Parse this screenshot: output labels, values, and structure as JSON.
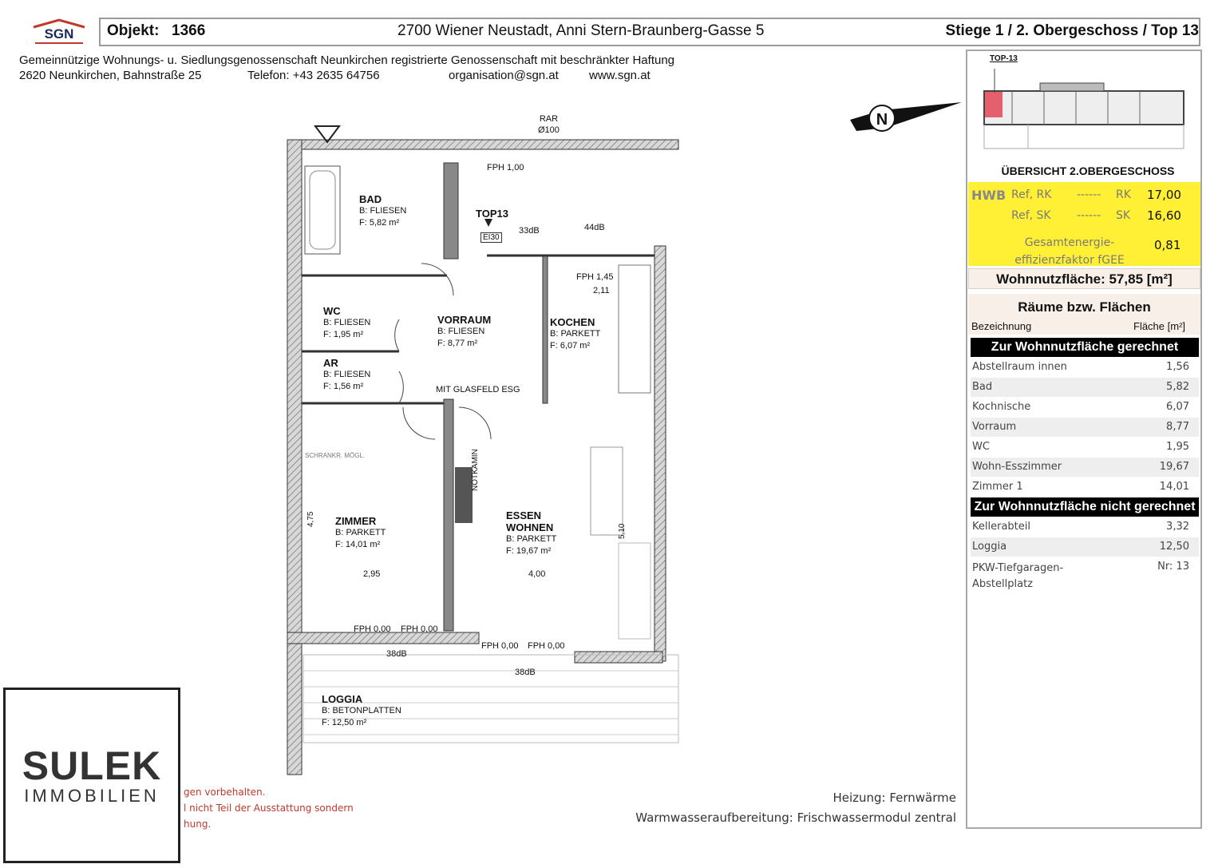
{
  "header": {
    "logo_text": "SGN",
    "objekt_label": "Objekt:",
    "objekt_number": "1366",
    "address": "2700 Wiener Neustadt, Anni Stern-Braunberg-Gasse 5",
    "stiege": "Stiege 1 / 2. Obergeschoss / Top 13"
  },
  "cooperative": {
    "line1": "Gemeinnützige Wohnungs- u. Siedlungsgenossenschaft Neunkirchen registrierte Genossenschaft mit beschränkter Haftung",
    "address": "2620 Neunkirchen, Bahnstraße 25",
    "phone": "Telefon: +43 2635 64756",
    "email": "organisation@sgn.at",
    "web": "www.sgn.at"
  },
  "plan": {
    "rooms": [
      {
        "name": "BAD",
        "floor": "B: FLIESEN",
        "area": "F: 5,82 m²"
      },
      {
        "name": "WC",
        "floor": "B: FLIESEN",
        "area": "F: 1,95 m²"
      },
      {
        "name": "AR",
        "floor": "B: FLIESEN",
        "area": "F: 1,56 m²"
      },
      {
        "name": "VORRAUM",
        "floor": "B: FLIESEN",
        "area": "F: 8,77 m²"
      },
      {
        "name": "KOCHEN",
        "floor": "B: PARKETT",
        "area": "F: 6,07 m²"
      },
      {
        "name": "ZIMMER",
        "floor": "B: PARKETT",
        "area": "F: 14,01 m²"
      },
      {
        "name": "ESSEN\nWOHNEN",
        "floor": "B: PARKETT",
        "area": "F: 19,67 m²"
      },
      {
        "name": "LOGGIA",
        "floor": "B: BETONPLATTEN",
        "area": "F: 12,50 m²"
      }
    ],
    "labels": {
      "top": "TOP13",
      "glasfeld": "MIT GLASFELD ESG",
      "notkamin": "NOTKAMIN",
      "fph_100": "FPH 1,00",
      "fph_145": "FPH 1,45",
      "fph_000a": "FPH 0,00",
      "fph_000b": "FPH 0,00",
      "fph_000c": "FPH 0,00",
      "fph_000d": "FPH 0,00",
      "rar": "RAR",
      "rar_d": "Ø100",
      "db33": "33dB",
      "db44": "44dB",
      "db38a": "38dB",
      "db38b": "38dB",
      "ei30": "EI30",
      "dim_295": "2,95",
      "dim_400": "4,00",
      "dim_211": "2,11",
      "dim_475": "4,75",
      "dim_510": "5,10",
      "schrank": "SCHRANKR. MÖGL."
    }
  },
  "overview": {
    "badge": "TOP-13",
    "title": "ÜBERSICHT 2.OBERGESCHOSS"
  },
  "hwb": {
    "label": "HWB",
    "ref_rk": "Ref, RK",
    "ref_sk": "Ref, SK",
    "dash1": "------",
    "dash2": "------",
    "rk": "RK",
    "sk": "SK",
    "rk_value": "17,00",
    "sk_value": "16,60",
    "fgee_line1": "Gesamtenergie-",
    "fgee_line2": "effizienzfaktor fGEE",
    "fgee_value": "0,81"
  },
  "summary": {
    "wohnnutzflaeche": "Wohnnutzfläche: 57,85 [m²]",
    "rooms_title": "Räume bzw. Flächen",
    "col_name": "Bezeichnung",
    "col_area": "Fläche [m²]",
    "section_included": "Zur Wohnnutzfläche gerechnet",
    "section_excluded": "Zur Wohnnutzfläche nicht gerechnet",
    "included": [
      {
        "name": "Abstellraum innen",
        "value": "1,56"
      },
      {
        "name": "Bad",
        "value": "5,82"
      },
      {
        "name": "Kochnische",
        "value": "6,07"
      },
      {
        "name": "Vorraum",
        "value": "8,77"
      },
      {
        "name": "WC",
        "value": "1,95"
      },
      {
        "name": "Wohn-Esszimmer",
        "value": "19,67"
      },
      {
        "name": "Zimmer 1",
        "value": "14,01"
      }
    ],
    "excluded": [
      {
        "name": "Kellerabteil",
        "value": "3,32"
      },
      {
        "name": "Loggia",
        "value": "12,50"
      },
      {
        "name": "PKW-Tiefgaragen-\nAbstellplatz",
        "value": "Nr: 13"
      }
    ]
  },
  "footer": {
    "heizung": "Heizung: Fernwärme",
    "warmwasser": "Warmwasseraufbereitung: Frischwassermodul zentral",
    "note1": "gen vorbehalten.",
    "note2": "l nicht Teil der Ausstattung sondern",
    "note3": "hung."
  },
  "brand": {
    "name": "SULEK",
    "sub": "IMMOBILIEN"
  }
}
